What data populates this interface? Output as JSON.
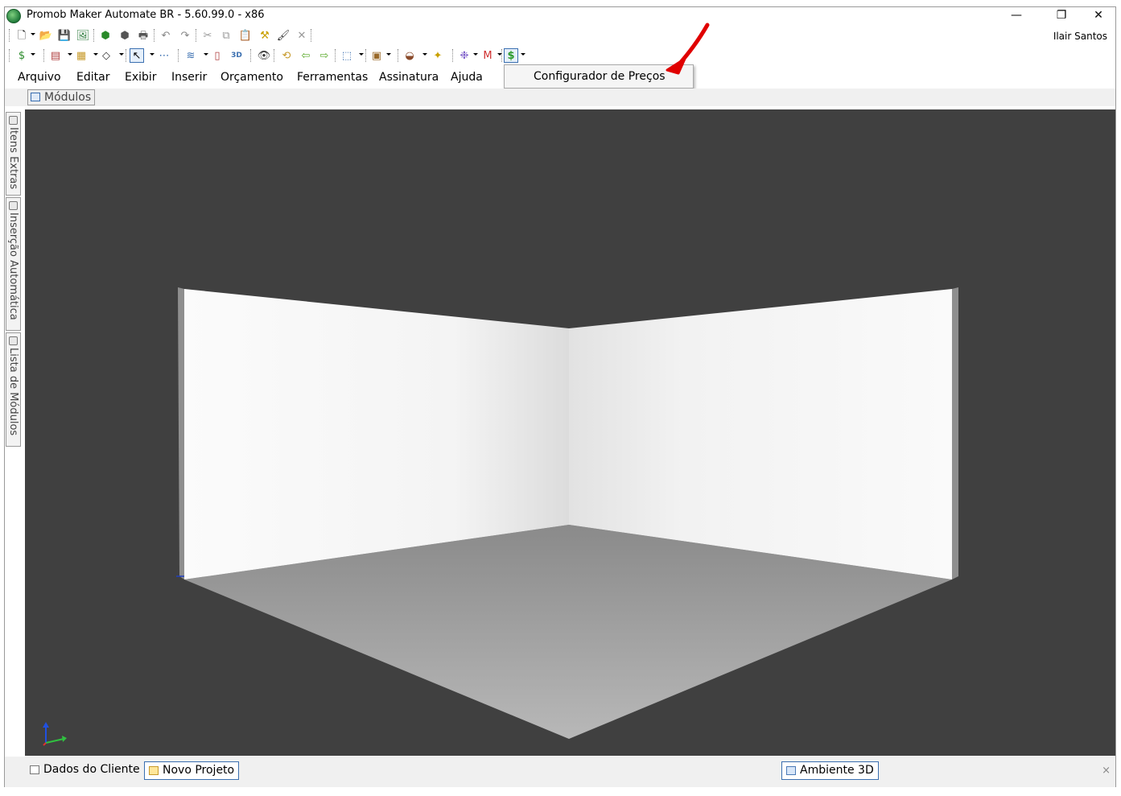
{
  "window": {
    "title": "Promob Maker Automate BR - 5.60.99.0 - x86",
    "min_glyph": "—",
    "max_glyph": "❐",
    "close_glyph": "✕"
  },
  "user": {
    "name": "Ilair Santos"
  },
  "toolbar1": [
    {
      "name": "new-icon",
      "glyph": "🗋",
      "color": "#1a1a1a"
    },
    {
      "name": "open-icon",
      "glyph": "📂",
      "color": "#c79a2b"
    },
    {
      "name": "save-icon",
      "glyph": "💾",
      "color": "#333333"
    },
    {
      "name": "export-image-icon",
      "glyph": "🖼",
      "color": "#2a7a3a"
    },
    {
      "name": "render-icon",
      "glyph": "⬢",
      "color": "#2a8a2a"
    },
    {
      "name": "render-settings-icon",
      "glyph": "⬢",
      "color": "#555555"
    },
    {
      "name": "print-icon",
      "glyph": "🖶",
      "color": "#555555"
    },
    {
      "name": "undo-icon",
      "glyph": "↶",
      "color": "#888888"
    },
    {
      "name": "redo-icon",
      "glyph": "↷",
      "color": "#888888"
    },
    {
      "name": "cut-icon",
      "glyph": "✂",
      "color": "#999999"
    },
    {
      "name": "copy-icon",
      "glyph": "⧉",
      "color": "#999999"
    },
    {
      "name": "paste-icon",
      "glyph": "📋",
      "color": "#999999"
    },
    {
      "name": "tool-hammer-icon",
      "glyph": "⚒",
      "color": "#c9a000"
    },
    {
      "name": "paint-roller-icon",
      "glyph": "🖌",
      "color": "#333333"
    },
    {
      "name": "delete-icon",
      "glyph": "✕",
      "color": "#999999"
    }
  ],
  "toolbar2": [
    {
      "name": "budget-icon",
      "glyph": "$",
      "color": "#2a8a2a"
    },
    {
      "name": "layers-icon",
      "glyph": "▤",
      "color": "#b04040"
    },
    {
      "name": "modules-icon",
      "glyph": "▦",
      "color": "#c79a2b"
    },
    {
      "name": "shape-icon",
      "glyph": "◇",
      "color": "#333333"
    },
    {
      "name": "select-pointer-icon",
      "glyph": "↖",
      "color": "#000000"
    },
    {
      "name": "dimension-icon",
      "glyph": "⋯",
      "color": "#3a6fb0"
    },
    {
      "name": "stack-icon",
      "glyph": "≋",
      "color": "#3a6fb0"
    },
    {
      "name": "door-icon",
      "glyph": "▯",
      "color": "#b04040"
    },
    {
      "name": "view-3d-icon",
      "glyph": "3D",
      "color": "#3a6fb0"
    },
    {
      "name": "eye-icon",
      "glyph": "👁",
      "color": "#3a3a3a"
    },
    {
      "name": "rotate-icon",
      "glyph": "⟲",
      "color": "#c79a2b"
    },
    {
      "name": "arrow-left-icon",
      "glyph": "⇦",
      "color": "#5aaa2a"
    },
    {
      "name": "arrow-right-icon",
      "glyph": "⇨",
      "color": "#5aaa2a"
    },
    {
      "name": "camera-view-icon",
      "glyph": "⬚",
      "color": "#3a6fb0"
    },
    {
      "name": "box-icon",
      "glyph": "▣",
      "color": "#9a6a2a"
    },
    {
      "name": "paint-icon",
      "glyph": "◒",
      "color": "#8a4a2a"
    },
    {
      "name": "light-icon",
      "glyph": "✦",
      "color": "#c9a000"
    },
    {
      "name": "sparkle-icon",
      "glyph": "❉",
      "color": "#7a5ac8"
    },
    {
      "name": "material-icon",
      "glyph": "M",
      "color": "#d03030"
    },
    {
      "name": "price-config-icon",
      "glyph": "$",
      "color": "#2a9a2a"
    }
  ],
  "menu": [
    {
      "label": "Arquivo"
    },
    {
      "label": "Editar"
    },
    {
      "label": "Exibir"
    },
    {
      "label": "Inserir"
    },
    {
      "label": "Orçamento"
    },
    {
      "label": "Ferramentas"
    },
    {
      "label": "Assinatura"
    },
    {
      "label": "Ajuda"
    }
  ],
  "popup": {
    "item": "Configurador de Preços",
    "arrow_color": "#e00000"
  },
  "modules_tab": {
    "label": "Módulos"
  },
  "side_tabs": [
    {
      "label": "Itens Extras"
    },
    {
      "label": "Inserção Automática"
    },
    {
      "label": "Lista de Módulos"
    }
  ],
  "bottom_tabs": {
    "left": [
      {
        "label": "Dados do Cliente"
      },
      {
        "label": "Novo Projeto"
      }
    ],
    "right": [
      {
        "label": "Ambiente 3D"
      }
    ],
    "close_glyph": "×"
  },
  "viewport": {
    "background": "#404040"
  }
}
